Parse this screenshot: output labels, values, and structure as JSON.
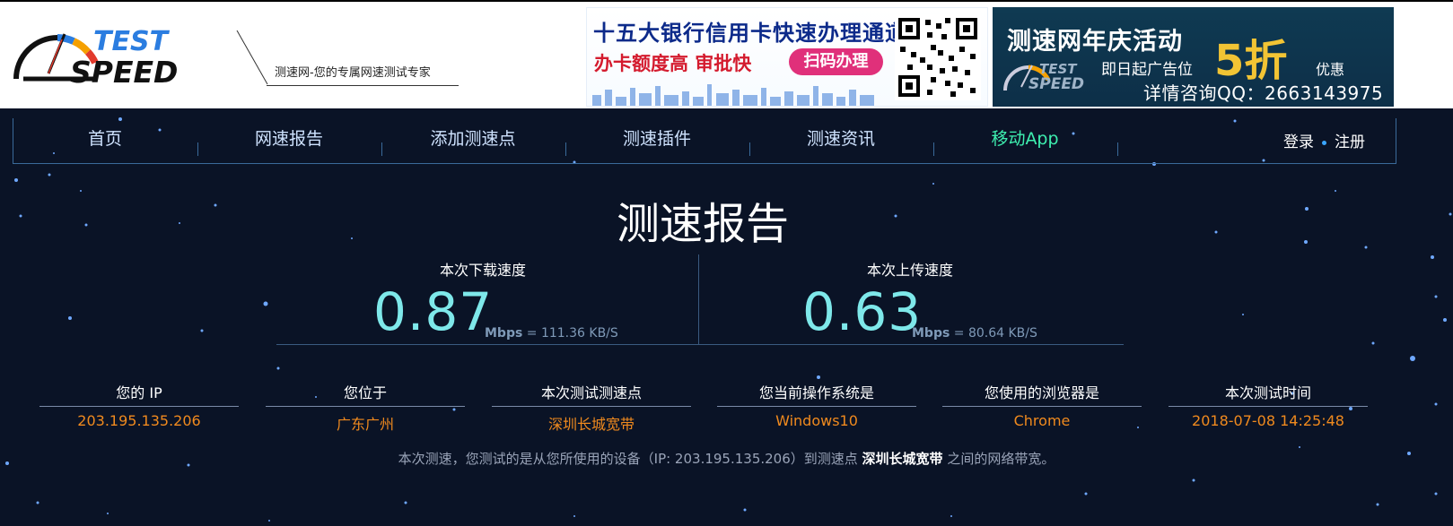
{
  "logo": {
    "line1": "TEST",
    "line2": "SPEED",
    "slogan": "测速网-您的专属网速测试专家"
  },
  "ad1": {
    "title": "十五大银行信用卡快速办理通道",
    "subtitle": "办卡额度高 审批快",
    "button": "扫码办理"
  },
  "ad2": {
    "title": "测速网年庆活动",
    "subtitle": "即日起广告位",
    "discount": "5折",
    "discount_suffix": "优惠",
    "contact": "详情咨询QQ：2663143975",
    "logo_line1": "TEST",
    "logo_line2": "SPEED"
  },
  "nav": {
    "items": [
      "首页",
      "网速报告",
      "添加测速点",
      "测速插件",
      "测速资讯",
      "移动App"
    ],
    "login": "登录",
    "register": "注册"
  },
  "report": {
    "title": "测速报告",
    "download": {
      "label": "本次下载速度",
      "value": "0.87",
      "unit": "Mbps",
      "equals": "= 111.36",
      "kb_unit": "KB/S"
    },
    "upload": {
      "label": "本次上传速度",
      "value": "0.63",
      "unit": "Mbps",
      "equals": "= 80.64",
      "kb_unit": "KB/S"
    }
  },
  "info": [
    {
      "label": "您的 IP",
      "value": "203.195.135.206"
    },
    {
      "label": "您位于",
      "value": "广东广州"
    },
    {
      "label": "本次测试测速点",
      "value": "深圳长城宽带"
    },
    {
      "label": "您当前操作系统是",
      "value": "Windows10"
    },
    {
      "label": "您使用的浏览器是",
      "value": "Chrome"
    },
    {
      "label": "本次测试时间",
      "value": "2018-07-08 14:25:48"
    }
  ],
  "description": {
    "prefix": "本次测速，您测试的是从您所使用的设备（IP: 203.195.135.206）到测速点",
    "server": "深圳长城宽带",
    "suffix": "之间的网络带宽。"
  },
  "colors": {
    "background": "#0a1326",
    "accent": "#7ee8ea",
    "value": "#f08a1e",
    "app": "#3ef0b0"
  }
}
